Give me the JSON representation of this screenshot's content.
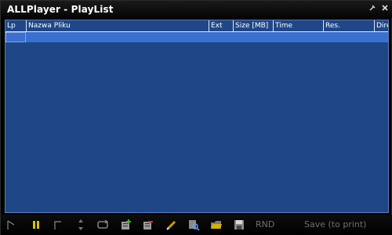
{
  "window": {
    "title": "ALLPlayer - PlayList"
  },
  "columns": [
    {
      "key": "lp",
      "label": "Lp"
    },
    {
      "key": "name",
      "label": "Nazwa Pliku"
    },
    {
      "key": "ext",
      "label": "Ext"
    },
    {
      "key": "size",
      "label": "Size [MB]"
    },
    {
      "key": "time",
      "label": "Time"
    },
    {
      "key": "res",
      "label": "Res."
    },
    {
      "key": "dir",
      "label": "Dire"
    }
  ],
  "toolbar": {
    "rnd_label": "RND",
    "save_label": "Save (to print)"
  },
  "icons": {
    "play": "play-icon",
    "pause": "pause-icon",
    "stop": "stop-icon",
    "sort": "sort-icon",
    "repeat": "repeat-icon",
    "add_files": "add-files-icon",
    "remove_files": "remove-files-icon",
    "edit": "edit-icon",
    "search": "search-icon",
    "open_folder": "open-folder-icon",
    "save": "save-icon"
  },
  "colors": {
    "list_background": "#1f4788",
    "selection": "#3a70d0",
    "header_text": "#ffffff",
    "title_bar": "#0a0a0a"
  }
}
